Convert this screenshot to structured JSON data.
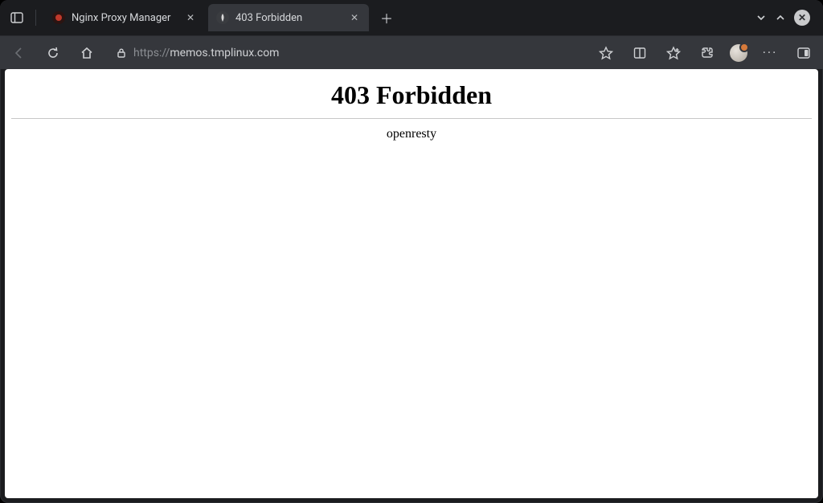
{
  "tabs": [
    {
      "label": "Nginx Proxy Manager",
      "favicon_color": "#c0392b",
      "active": false
    },
    {
      "label": "403 Forbidden",
      "favicon_color": "#e8e8e8",
      "active": true
    }
  ],
  "address_bar": {
    "scheme": "https://",
    "domain": "memos.tmplinux.com",
    "path": ""
  },
  "page": {
    "heading": "403 Forbidden",
    "server": "openresty"
  }
}
